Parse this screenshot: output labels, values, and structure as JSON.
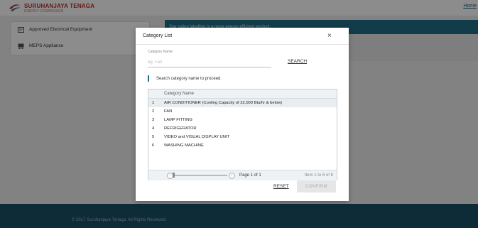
{
  "header": {
    "brand": "SURUHANJAYA TENAGA",
    "brand_sub": "ENERGY COMMISSION",
    "home_link": "Home"
  },
  "sidebar": {
    "items": [
      {
        "label": "Approved Electrical Equipment",
        "icon": "certificate-icon"
      },
      {
        "label": "MEPS Appliance",
        "icon": "appliance-icon"
      }
    ]
  },
  "banner": {
    "text": "Star rating labelling is a more energy efficient product."
  },
  "footer": {
    "copyright": "© 2017 Suruhanjaya Tenaga. All Rights Reserved."
  },
  "modal": {
    "title": "Category List",
    "close_icon": "×",
    "field_label": "Category Name",
    "placeholder": "eg. Fan",
    "search_label": "SEARCH",
    "hint": "Search category name to proceed.",
    "grid": {
      "column_header": "Category Name",
      "rows": [
        {
          "num": "1",
          "name": "AIR CONDITIONER (Cooling Capacity of 32,000 Btu/hr & below)"
        },
        {
          "num": "2",
          "name": "FAN"
        },
        {
          "num": "3",
          "name": "LAMP FITTING"
        },
        {
          "num": "4",
          "name": "REFRIGERATOR"
        },
        {
          "num": "5",
          "name": "VIDEO and VISUAL DISPLAY UNIT"
        },
        {
          "num": "6",
          "name": "WASHING MACHINE"
        }
      ],
      "pager": {
        "page_text": "Page 1 of 1",
        "count_text": "Item 1 to 6 of 6"
      }
    },
    "reset_label": "RESET",
    "confirm_label": "CONFIRM"
  }
}
